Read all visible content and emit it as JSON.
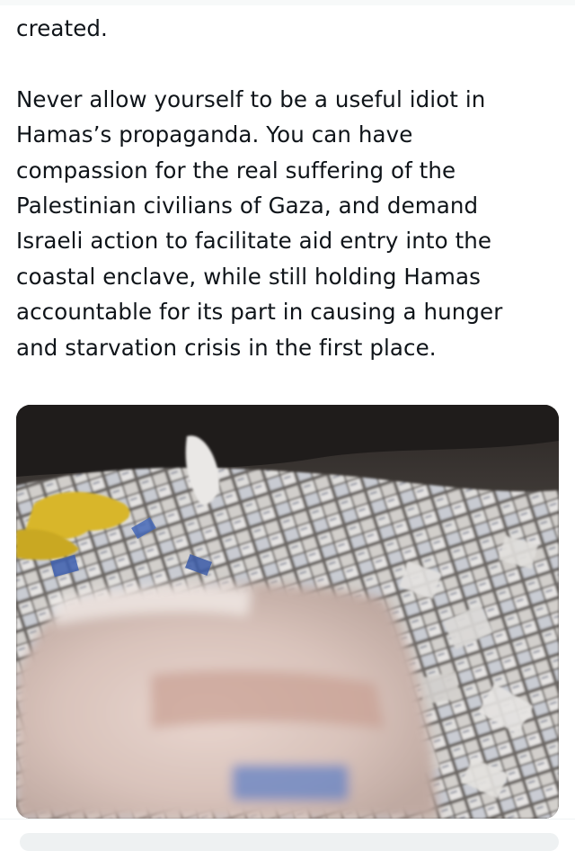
{
  "tweet": {
    "lines_para1": [
      "created."
    ],
    "lines_para2": [
      "Never allow yourself to be a useful idiot in",
      "Hamas’s propaganda. You can have",
      "compassion for the real suffering of the",
      "Palestinian civilians of Gaza, and demand",
      "Israeli action to facilitate aid entry into the",
      "coastal enclave, while still holding Hamas",
      "accountable for its part in causing a hunger",
      "and starvation crisis in the first place."
    ]
  },
  "colors": {
    "text": "#0f1419",
    "background": "#ffffff",
    "divider": "#eff3f4"
  }
}
